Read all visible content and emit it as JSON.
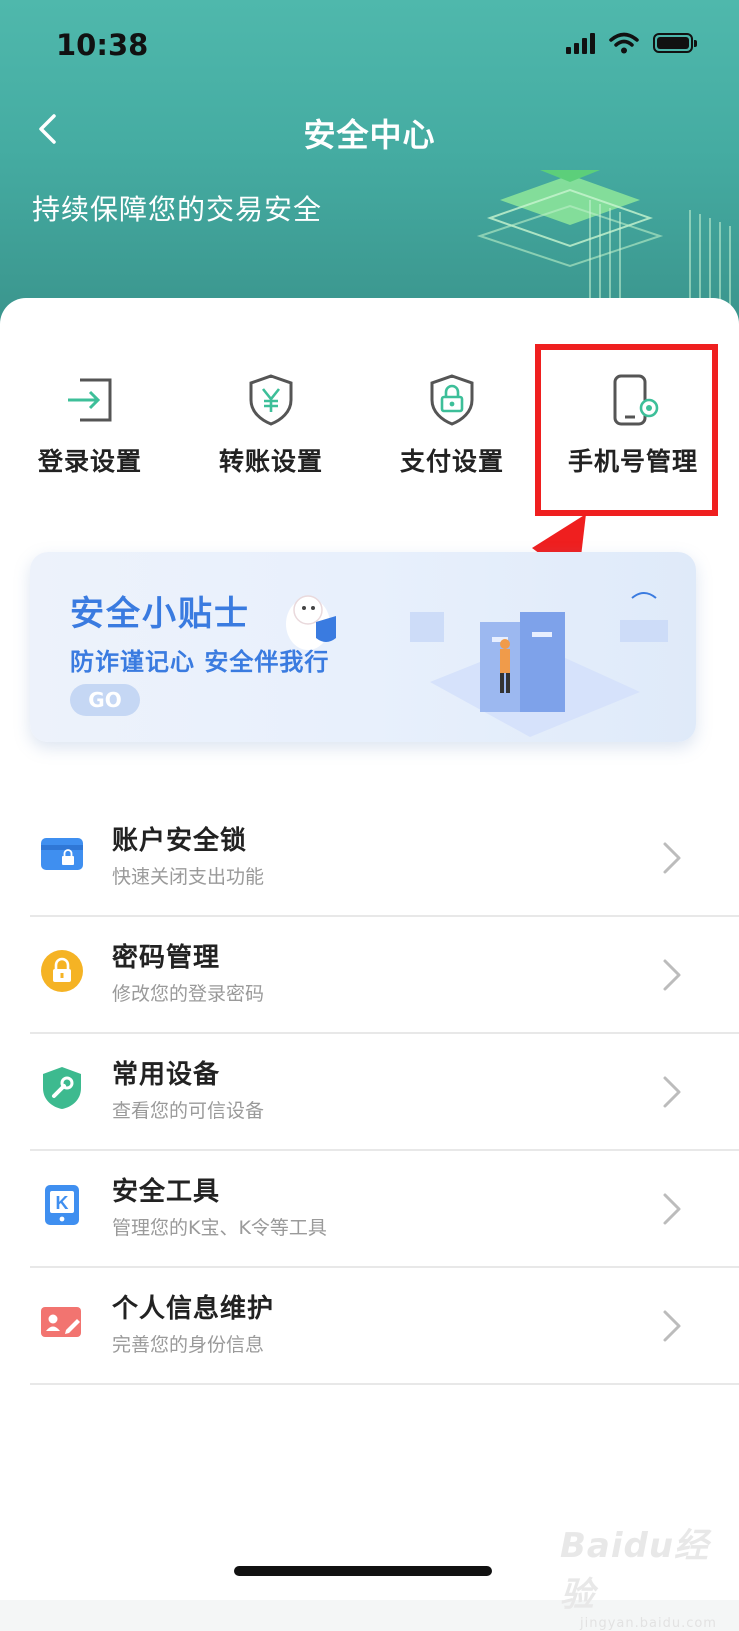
{
  "status_bar": {
    "time": "10:38"
  },
  "nav": {
    "title": "安全中心"
  },
  "banner": {
    "text": "持续保障您的交易安全"
  },
  "quick_actions": [
    {
      "label": "登录设置",
      "icon": "login-icon"
    },
    {
      "label": "转账设置",
      "icon": "yuan-shield-icon"
    },
    {
      "label": "支付设置",
      "icon": "lock-shield-icon"
    },
    {
      "label": "手机号管理",
      "icon": "phone-settings-icon"
    }
  ],
  "tips": {
    "title": "安全小贴士",
    "subtitle": "防诈谨记心 安全伴我行",
    "go_label": "GO"
  },
  "list": [
    {
      "title": "账户安全锁",
      "subtitle": "快速关闭支出功能",
      "icon": "card-lock-icon",
      "color": "#3f8ff0"
    },
    {
      "title": "密码管理",
      "subtitle": "修改您的登录密码",
      "icon": "padlock-icon",
      "color": "#f5b324"
    },
    {
      "title": "常用设备",
      "subtitle": "查看您的可信设备",
      "icon": "wrench-shield-icon",
      "color": "#3dba8f"
    },
    {
      "title": "安全工具",
      "subtitle": "管理您的K宝、K令等工具",
      "icon": "k-token-icon",
      "color": "#3f8ff0"
    },
    {
      "title": "个人信息维护",
      "subtitle": "完善您的身份信息",
      "icon": "id-card-edit-icon",
      "color": "#f27470"
    }
  ],
  "watermark": {
    "brand": "Baidu经验",
    "url": "jingyan.baidu.com"
  },
  "colors": {
    "header": "#45aca2",
    "accent_blue": "#3a7be0",
    "highlight": "#ef1f1f"
  }
}
